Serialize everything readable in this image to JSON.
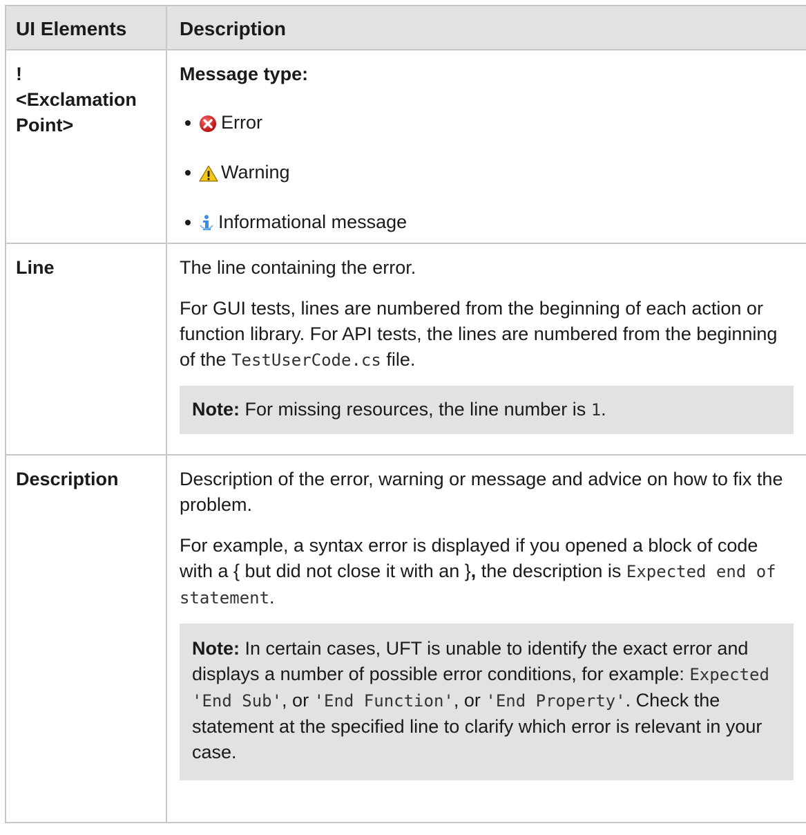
{
  "table": {
    "headers": [
      "UI Elements",
      "Description"
    ],
    "rows": {
      "message": {
        "term_line1": "!",
        "term_line2": "<Exclamation Point>",
        "title": "Message type:",
        "types": [
          {
            "icon": "error-icon",
            "label": "Error"
          },
          {
            "icon": "warning-icon",
            "label": "Warning"
          },
          {
            "icon": "info-icon",
            "label": "Informational message"
          }
        ]
      },
      "line": {
        "term": "Line",
        "p1": "The line containing the error.",
        "p2_a": "For GUI tests, lines are numbered from the beginning of each action or function library. For API tests, the lines are numbered from the beginning of the ",
        "p2_code": "TestUserCode.cs",
        "p2_b": " file.",
        "note_label": "Note:",
        "note_a": " For missing resources, the line number is ",
        "note_code": "1",
        "note_b": "."
      },
      "description": {
        "term": "Description",
        "p1": "Description of the error, warning or message and advice on how to fix the problem.",
        "p2_a": "For example, a syntax error is displayed if you opened a block of code with a { but did not close it with an }",
        "p2_comma": ",",
        "p2_b": " the description is ",
        "p2_code": "Expected end of statement",
        "p2_c": ".",
        "note_label": "Note:",
        "note_a": " In certain cases, UFT is unable to identify the exact error and displays a number of possible error conditions, for example: ",
        "note_code1": "Expected 'End Sub'",
        "note_b": ", or ",
        "note_code2": "'End Function'",
        "note_c": ", or ",
        "note_code3": "'End Property'",
        "note_d": ". Check the statement at the specified line to clarify which error is relevant in your case."
      }
    }
  },
  "colors": {
    "header_bg": "#e2e2e2",
    "border": "#c7c7c7",
    "note_bg": "#e2e2e2",
    "error_red": "#d21f1f",
    "warning_yellow": "#f5c518",
    "info_blue": "#3a8ee6"
  }
}
